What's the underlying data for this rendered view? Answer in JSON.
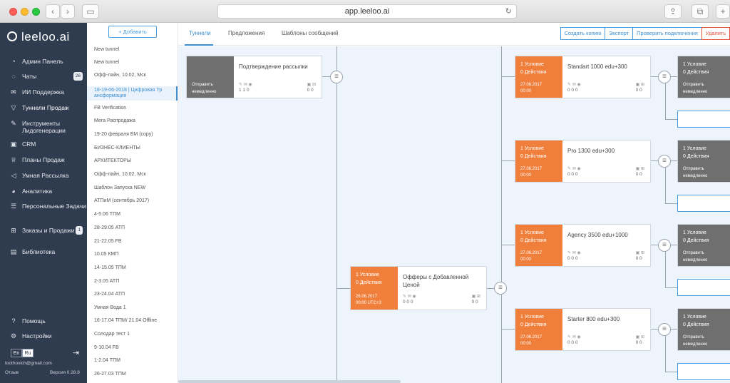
{
  "browser": {
    "url": "app.leeloo.ai",
    "reload_icon": "reload-icon",
    "share_icon": "share-icon",
    "tabs_icon": "tabs-icon",
    "new_tab": "+"
  },
  "sidebar": {
    "logo": "leeloo.ai",
    "items": [
      {
        "label": "Админ Панель",
        "icon": "dashboard-icon"
      },
      {
        "label": "Чаты",
        "icon": "chat-icon",
        "count": "26"
      },
      {
        "label": "ИИ Поддержка",
        "icon": "mail-icon"
      },
      {
        "label": "Туннели Продаж",
        "icon": "funnel-icon"
      },
      {
        "label": "Инструменты Лидогенерации",
        "icon": "tools-icon"
      },
      {
        "label": "CRM",
        "icon": "crm-icon"
      },
      {
        "label": "Планы Продаж",
        "icon": "trophy-icon"
      },
      {
        "label": "Умная Рассылка",
        "icon": "megaphone-icon"
      },
      {
        "label": "Аналитика",
        "icon": "pie-chart-icon"
      },
      {
        "label": "Персональные Задачи",
        "icon": "tasks-icon"
      },
      {
        "label": "Заказы и Продажи",
        "icon": "cart-icon",
        "count": "1"
      },
      {
        "label": "Библиотека",
        "icon": "library-icon"
      }
    ],
    "help": "Помощь",
    "settings": "Настройки",
    "lang_en": "En",
    "lang_ru": "Ru",
    "email": "toothovich@gmail.com",
    "feedback": "Отзыв",
    "version": "Версия 0.28.8"
  },
  "tunnel_list": {
    "add_button": "+ Добавить",
    "items": [
      "New tunnel",
      "New tunnel",
      "Офф-лайн, 10.02, Мск",
      "18-19-06-2018 | Цифровая Тр ансформация",
      "FB Verification",
      "Мега Распродажа",
      "19-20 февраля БМ (copy)",
      "БИЗНЕС-КЛИЕНТЫ",
      "АРХИТЕКТОРЫ",
      "Офф-лайн, 10.02, Мск",
      "Шаблон Запуска NEW",
      "АТПиМ (сентябрь 2017)",
      "4-5.06 ТПМ",
      "28-29.05 АТП",
      "21-22.05 FB",
      "10.05 КМП",
      "14-15.05 ТПМ",
      "2-3.05 АТП",
      "23-24.04 АТП",
      "Умная Вода 1",
      "16-17.04 ТПМ/ 21.04 Offline",
      "Солодар тест 1",
      "9-10.04 FB",
      "1-2.04 ТПМ",
      "26-27.03 ТПМ"
    ]
  },
  "tabs": [
    "Туннели",
    "Предложения",
    "Шаблоны сообщений"
  ],
  "actions": {
    "copy": "Создать копию",
    "export": "Экспорт",
    "check": "Проверить подключения",
    "delete": "Удалить"
  },
  "canvas": {
    "root": {
      "side_line1": "Отправить",
      "side_line2": "немедленно",
      "title": "Подтверждение рассылки",
      "stats_left": "1   1   0",
      "stats_right": "0   0"
    },
    "offer": {
      "cond": "1 Условие",
      "acts": "0 Действия",
      "date": "26.06.2017",
      "time": "00:00 UTC+3",
      "title": "Офферы с Добавленной Ценой",
      "stats_left": "0   0   0",
      "stats_right": "0   0"
    },
    "branches": [
      {
        "cond": "1 Условие",
        "acts": "0 Действия",
        "date": "27.06.2017",
        "time": "00:00",
        "title": "Standart 1000 edu+300",
        "stats_left": "0   0   0",
        "stats_right": "0   0"
      },
      {
        "cond": "1 Условие",
        "acts": "0 Действия",
        "date": "27.06.2017",
        "time": "00:00",
        "title": "Pro 1300 edu+300",
        "stats_left": "0   0   0",
        "stats_right": "0   0"
      },
      {
        "cond": "1 Условие",
        "acts": "0 Действия",
        "date": "27.06.2017",
        "time": "00:00",
        "title": "Agency 3500 edu+1000",
        "stats_left": "0   0   0",
        "stats_right": "0   0"
      },
      {
        "cond": "1 Условие",
        "acts": "0 Действия",
        "date": "27.06.2017",
        "time": "00:00",
        "title": "Starter 800 edu+300",
        "stats_left": "0   0   0",
        "stats_right": "0   0"
      }
    ],
    "gray_nodes": [
      {
        "cond": "1 Условие",
        "acts": "0 Действия",
        "send1": "Отправить",
        "send2": "немедленно"
      },
      {
        "cond": "1 Условие",
        "acts": "0 Действия",
        "send1": "Отправить",
        "send2": "немедленно"
      },
      {
        "cond": "1 Условие",
        "acts": "0 Действия",
        "send1": "Отправить",
        "send2": "немедленно"
      },
      {
        "cond": "1 Условие",
        "acts": "0 Действия",
        "send1": "Отправить",
        "send2": "немедленно"
      }
    ]
  },
  "colors": {
    "sidebar_bg": "#2f3b4e",
    "accent": "#3d8fd1",
    "orange": "#f07f3c",
    "gray_node": "#6f6f6f",
    "danger": "#e5533d",
    "canvas_bg": "#eef4fb"
  }
}
